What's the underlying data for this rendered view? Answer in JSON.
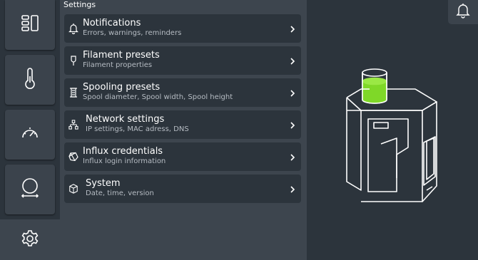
{
  "header": {
    "title": "Settings"
  },
  "sidebar": {
    "items": [
      {
        "name": "dashboard",
        "icon": "layout-grid-icon"
      },
      {
        "name": "temperature",
        "icon": "thermometer-icon"
      },
      {
        "name": "speed",
        "icon": "gauge-icon"
      },
      {
        "name": "spool",
        "icon": "spool-icon"
      },
      {
        "name": "settings",
        "icon": "gear-icon",
        "active": true
      }
    ]
  },
  "settings": {
    "items": [
      {
        "title": "Notifications",
        "subtitle": "Errors, warnings, reminders",
        "icon": "bell-icon"
      },
      {
        "title": "Filament presets",
        "subtitle": "Filament properties",
        "icon": "filament-icon"
      },
      {
        "title": "Spooling presets",
        "subtitle": "Spool diameter, Spool width, Spool height",
        "icon": "spool-preset-icon"
      },
      {
        "title": "Network settings",
        "subtitle": "IP settings, MAC adress, DNS",
        "icon": "network-icon"
      },
      {
        "title": "Influx credentials",
        "subtitle": "Influx login information",
        "icon": "influx-icon"
      },
      {
        "title": "System",
        "subtitle": "Date, time, version",
        "icon": "system-cube-icon"
      }
    ]
  },
  "colors": {
    "rail_bg": "#2c343c",
    "button_bg": "#3b434c",
    "main_bg": "#3d454e",
    "item_bg": "#2c343c",
    "accent_green": "#7fd828"
  }
}
